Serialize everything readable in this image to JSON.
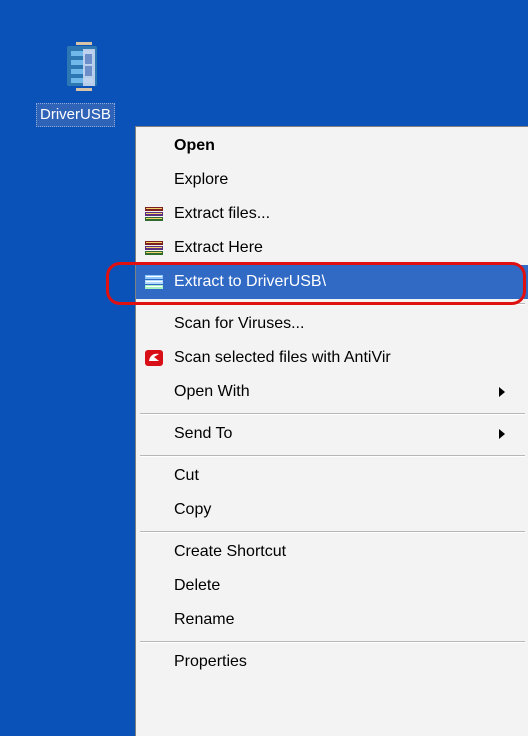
{
  "desktop": {
    "background_color": "#0a52b8",
    "icons": [
      {
        "label": "DriverUSB",
        "icon": "winrar-archive-icon"
      }
    ]
  },
  "context_menu": {
    "items": [
      {
        "label": "Open",
        "bold": true
      },
      {
        "label": "Explore"
      },
      {
        "label": "Extract files...",
        "icon": "winrar-books-icon"
      },
      {
        "label": "Extract Here",
        "icon": "winrar-books-icon"
      },
      {
        "label": "Extract to DriverUSB\\",
        "icon": "winrar-books-icon",
        "highlighted": true,
        "annotated": true
      },
      {
        "label": "Scan for Viruses..."
      },
      {
        "label": "Scan selected files with AntiVir",
        "icon": "antivir-umbrella-icon"
      },
      {
        "label": "Open With",
        "submenu": true
      },
      {
        "label": "Send To",
        "submenu": true
      },
      {
        "label": "Cut"
      },
      {
        "label": "Copy"
      },
      {
        "label": "Create Shortcut"
      },
      {
        "label": "Delete"
      },
      {
        "label": "Rename"
      },
      {
        "label": "Properties"
      }
    ],
    "highlight_color": "#316ac5",
    "annotation_color": "#e01010"
  }
}
